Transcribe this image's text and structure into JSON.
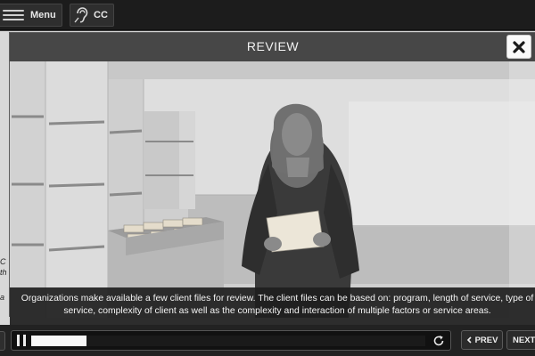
{
  "topbar": {
    "menu_label": "Menu",
    "cc_label": "CC"
  },
  "background_page": {
    "side_text_1": "C",
    "side_text_2": "th",
    "side_text_3": "a"
  },
  "modal": {
    "title": "REVIEW",
    "caption": "Organizations make available a few client files for review. The client files can be based on: program, length of service, type of service, complexity of client as well as the complexity and interaction of multiple factors or service areas."
  },
  "player": {
    "progress": 0.14
  },
  "nav": {
    "prev_label": "PREV",
    "next_label": "NEXT"
  },
  "icons": {
    "menu": "hamburger-icon",
    "cc": "hearing-icon",
    "close": "close-icon",
    "pause": "pause-icon",
    "replay": "replay-icon",
    "prev": "chevron-left-icon"
  },
  "colors": {
    "bar_bg": "#1c1c1c",
    "modal_bg": "#4a4a4a",
    "caption_bg": "#1e1e1e",
    "progress_fill": "#f8f8f8"
  }
}
